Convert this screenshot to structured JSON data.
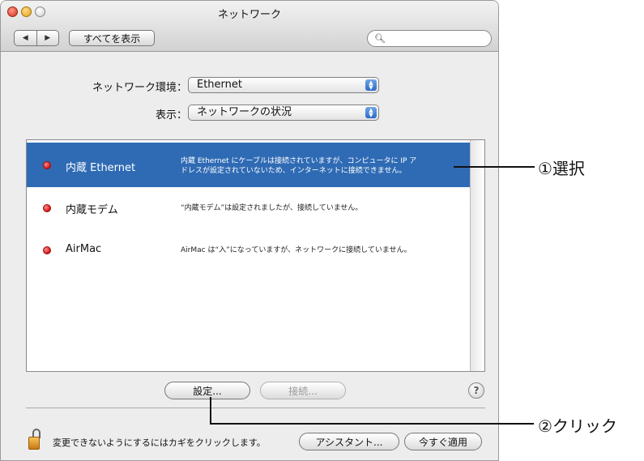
{
  "window": {
    "title": "ネットワーク",
    "back_glyph": "◀",
    "forward_glyph": "▶",
    "show_all_label": "すべてを表示",
    "search_icon_glyph": "🔍︎",
    "search_value": ""
  },
  "location": {
    "label": "ネットワーク環境：",
    "value": "Ethernet"
  },
  "show": {
    "label": "表示：",
    "value": "ネットワークの状況"
  },
  "services": [
    {
      "name": "内蔵 Ethernet",
      "status_color": "#d11616",
      "selected": true,
      "desc_line1": "内蔵 Ethernet にケーブルは接続されていますが、コンピュータに IP ア",
      "desc_line2": "ドレスが設定されていないため、インターネットに接続できません。"
    },
    {
      "name": "内蔵モデム",
      "status_color": "#d11616",
      "selected": false,
      "desc_line1": "“内蔵モデム”は設定されましたが、接続していません。",
      "desc_line2": ""
    },
    {
      "name": "AirMac",
      "status_color": "#d11616",
      "selected": false,
      "desc_line1": "AirMac は“入”になっていますが、ネットワークに接続していません。",
      "desc_line2": ""
    }
  ],
  "buttons": {
    "configure": "設定...",
    "connect": "接続...",
    "help": "?",
    "assistant": "アシスタント...",
    "apply_now": "今すぐ適用"
  },
  "lock_text": "変更できないようにするにはカギをクリックします。",
  "annotations": {
    "select": "①選択",
    "click": "②クリック"
  }
}
